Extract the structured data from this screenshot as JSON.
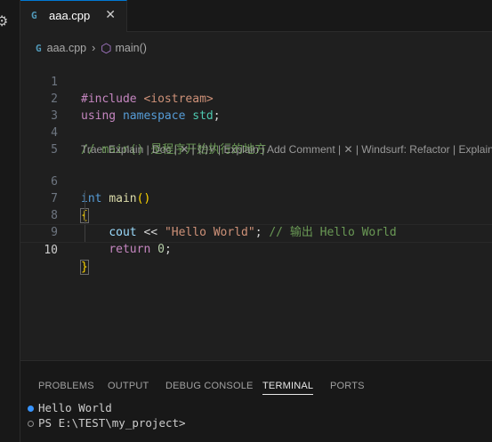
{
  "left_strip": {
    "gear_icon": "gear-icon"
  },
  "tab": {
    "label": "aaa.cpp",
    "icon": "C++",
    "close": "✕"
  },
  "breadcrumb": {
    "file": "aaa.cpp",
    "symbol": "main()"
  },
  "code_lens": "Trae: Explain | Doc | ✕ | ⟨/⟩˅ | Explain | Add Comment | ✕ | Windsurf: Refactor | Explain",
  "editor": {
    "lines": [
      {
        "n": "1",
        "include_kw": "#include",
        "include_hdr": "<iostream>"
      },
      {
        "n": "2",
        "using": "using",
        "namespace": "namespace",
        "std": "std",
        "semi": ";"
      },
      {
        "n": "3"
      },
      {
        "n": "4",
        "comment": "// main() 是程序开始执行的地方"
      },
      {
        "n": "5"
      },
      {
        "n": "6",
        "int": "int",
        "main": "main",
        "parens": "()"
      },
      {
        "n": "7",
        "brace": "{"
      },
      {
        "n": "8",
        "cout": "cout",
        "op": "<<",
        "str": "\"Hello World\"",
        "semi": ";",
        "comment": "// 输出 Hello World"
      },
      {
        "n": "9",
        "ret": "return",
        "zero": "0",
        "semi": ";"
      },
      {
        "n": "10",
        "brace": "}"
      }
    ]
  },
  "panel": {
    "tabs": [
      "PROBLEMS",
      "OUTPUT",
      "DEBUG CONSOLE",
      "TERMINAL",
      "PORTS"
    ],
    "active_tab": "TERMINAL",
    "terminal": [
      "Hello World",
      "PS E:\\TEST\\my_project>"
    ]
  },
  "colors": {
    "accent": "#0078d4",
    "terminal_dot": "#3794ff"
  }
}
